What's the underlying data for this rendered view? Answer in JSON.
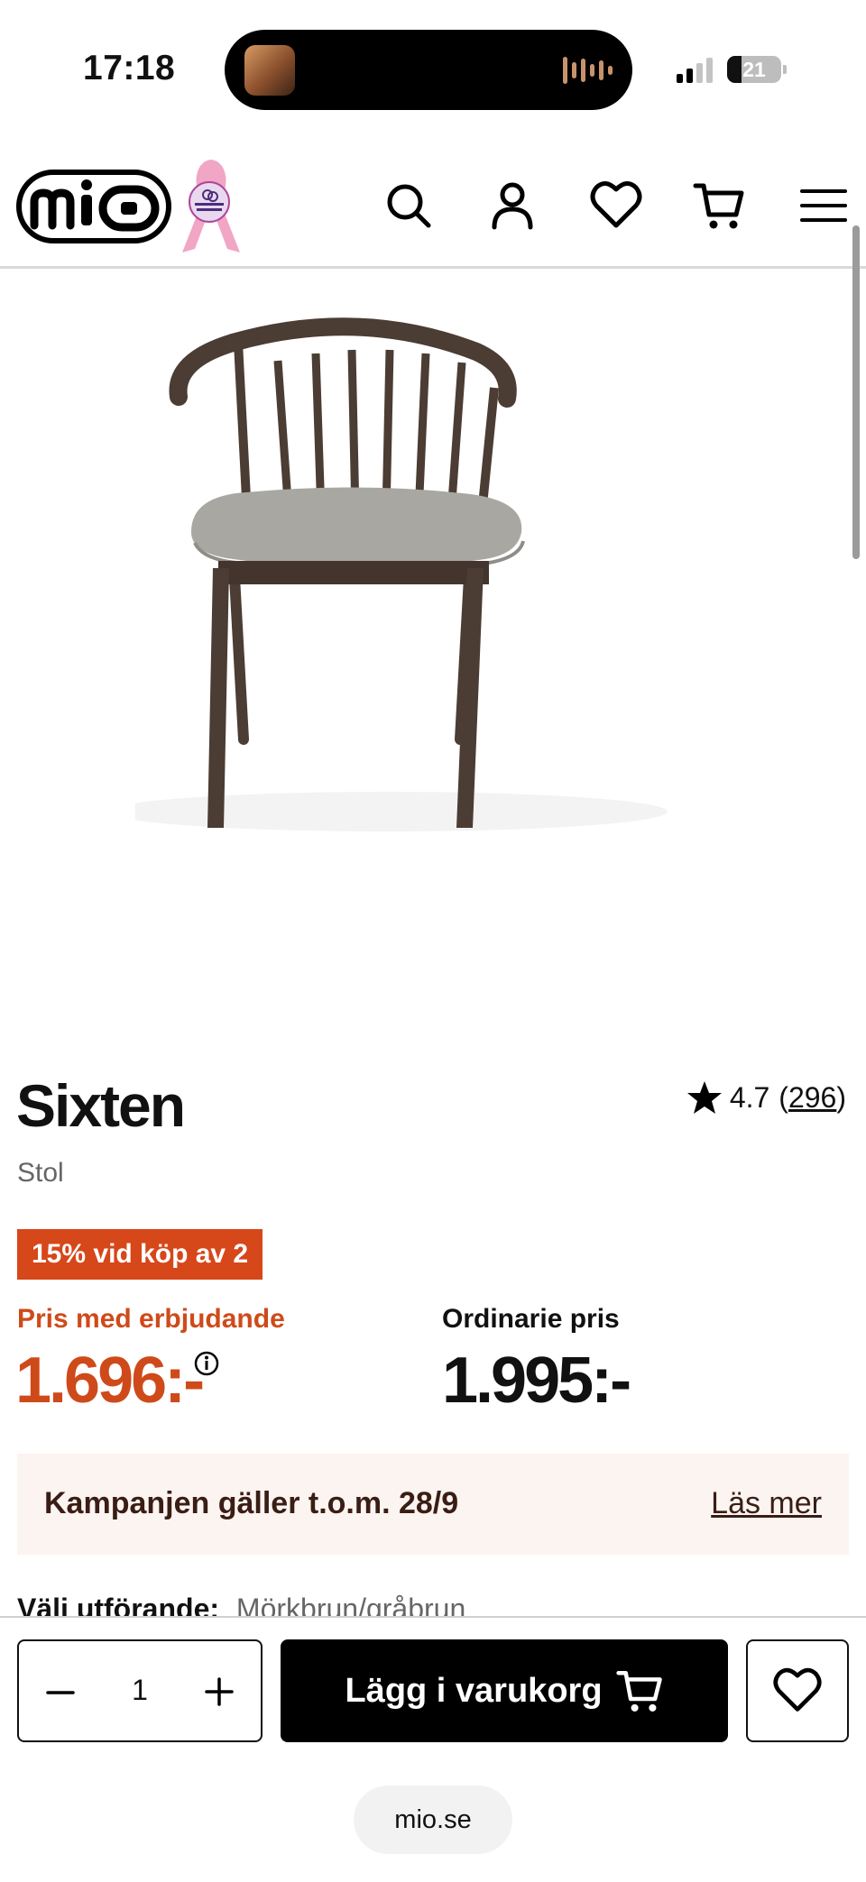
{
  "status_bar": {
    "time": "17:18",
    "battery": "21",
    "icons": [
      "now-playing-art",
      "audio-waveform-icon",
      "signal-icon",
      "battery-icon"
    ]
  },
  "header": {
    "logo_text": "mio",
    "ribbon_text": "CANCER FONDEN",
    "icons": [
      "search-icon",
      "account-icon",
      "heart-icon",
      "cart-icon",
      "menu-icon"
    ]
  },
  "product": {
    "title": "Sixten",
    "subtitle": "Stol",
    "rating_value": "4.7",
    "rating_open": "(",
    "rating_count": "296",
    "rating_close": ")",
    "promo_badge": "15% vid köp av 2",
    "offer_price_label": "Pris med erbjudande",
    "offer_price": "1.696:-",
    "regular_price_label": "Ordinarie pris",
    "regular_price": "1.995:-"
  },
  "campaign": {
    "text": "Kampanjen gäller t.o.m. 28/9",
    "link": "Läs mer"
  },
  "variant": {
    "label": "Välj utförande:",
    "value": "Mörkbrun/gråbrun"
  },
  "cart_bar": {
    "quantity": "1",
    "add_to_cart_label": "Lägg i varukorg",
    "url": "mio.se"
  },
  "colors": {
    "accent_orange": "#d6471a",
    "campaign_bg": "#fbf4f1",
    "text_dark": "#111111"
  }
}
